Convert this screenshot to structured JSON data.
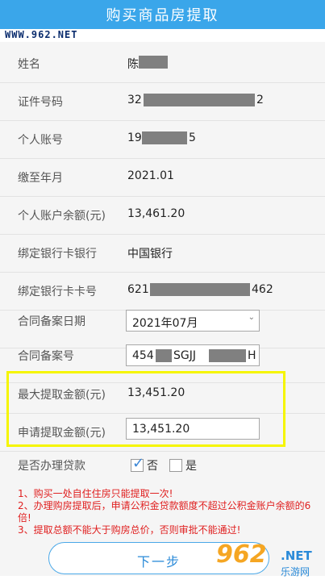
{
  "header": {
    "title": "购买商品房提取",
    "watermark": "WWW.962.NET"
  },
  "fields": [
    {
      "label": "姓名",
      "value": "陈"
    },
    {
      "label": "证件号码",
      "value": "32",
      "suffix": "2"
    },
    {
      "label": "个人账号",
      "value": "19",
      "suffix": "5"
    },
    {
      "label": "缴至年月",
      "value": "2021.01"
    },
    {
      "label": "个人账户余额(元)",
      "value": "13,461.20"
    },
    {
      "label": "绑定银行卡银行",
      "value": "中国银行"
    },
    {
      "label": "绑定银行卡卡号",
      "value": "621",
      "suffix": "462"
    },
    {
      "label": "合同备案日期",
      "value": "2021年07月"
    },
    {
      "label": "合同备案号",
      "value": "454",
      "middle": "SGJJ",
      "suffix": "H"
    },
    {
      "label": "最大提取金额(元)",
      "value": "13,451.20"
    },
    {
      "label": "申请提取金额(元)",
      "value": "13,451.20"
    }
  ],
  "loan": {
    "label": "是否办理贷款",
    "option_no": "否",
    "option_yes": "是",
    "selected": "否"
  },
  "notes": [
    "1、购买一处自住住房只能提取一次!",
    "2、办理购房提取后，申请公积金贷款额度不超过公积金账户余额的6倍!",
    "3、提取总额不能大于购房总价，否则审批不能通过!"
  ],
  "actions": {
    "next_label": "下一步"
  },
  "brand": {
    "logo_main": "962",
    "logo_net": ".NET",
    "logo_sub": "乐游网"
  },
  "colors": {
    "header": "#3aa6ea",
    "highlight": "#f5f500",
    "notes": "#e02020",
    "button_text": "#2a8ad8"
  }
}
